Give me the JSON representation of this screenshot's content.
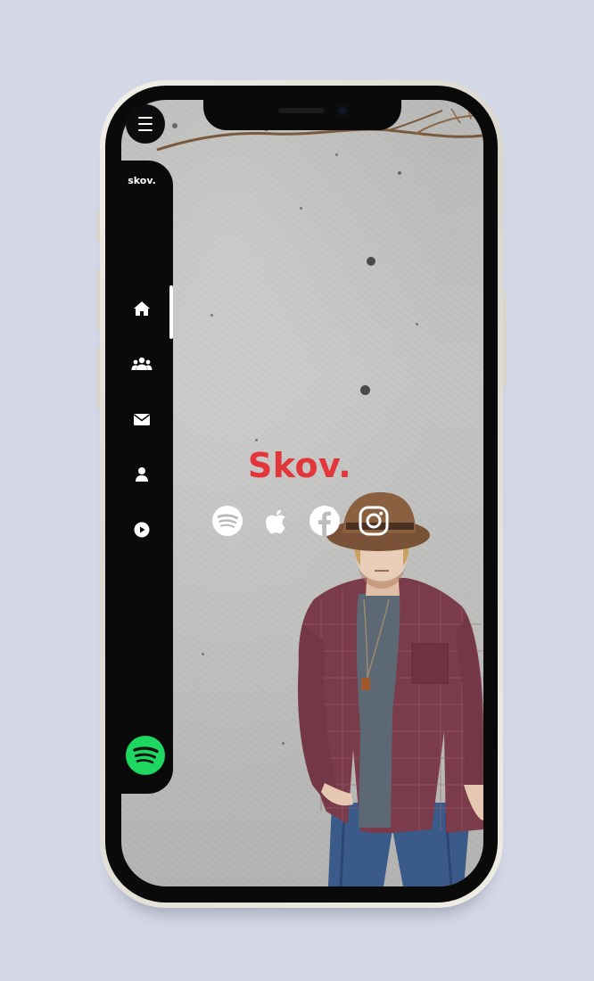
{
  "app": {
    "brand": "skov.",
    "title": "Skov."
  },
  "nav": {
    "items": [
      {
        "icon": "home-icon",
        "active": true
      },
      {
        "icon": "users-icon",
        "active": false
      },
      {
        "icon": "mail-icon",
        "active": false
      },
      {
        "icon": "user-icon",
        "active": false
      },
      {
        "icon": "play-icon",
        "active": false
      }
    ]
  },
  "social": [
    {
      "icon": "spotify-icon"
    },
    {
      "icon": "apple-icon"
    },
    {
      "icon": "facebook-icon"
    },
    {
      "icon": "instagram-icon"
    }
  ],
  "colors": {
    "title": "#e2363b",
    "spotify": "#1ed760",
    "sidebar": "#0a0a0b",
    "background": "#d3d7e6"
  }
}
